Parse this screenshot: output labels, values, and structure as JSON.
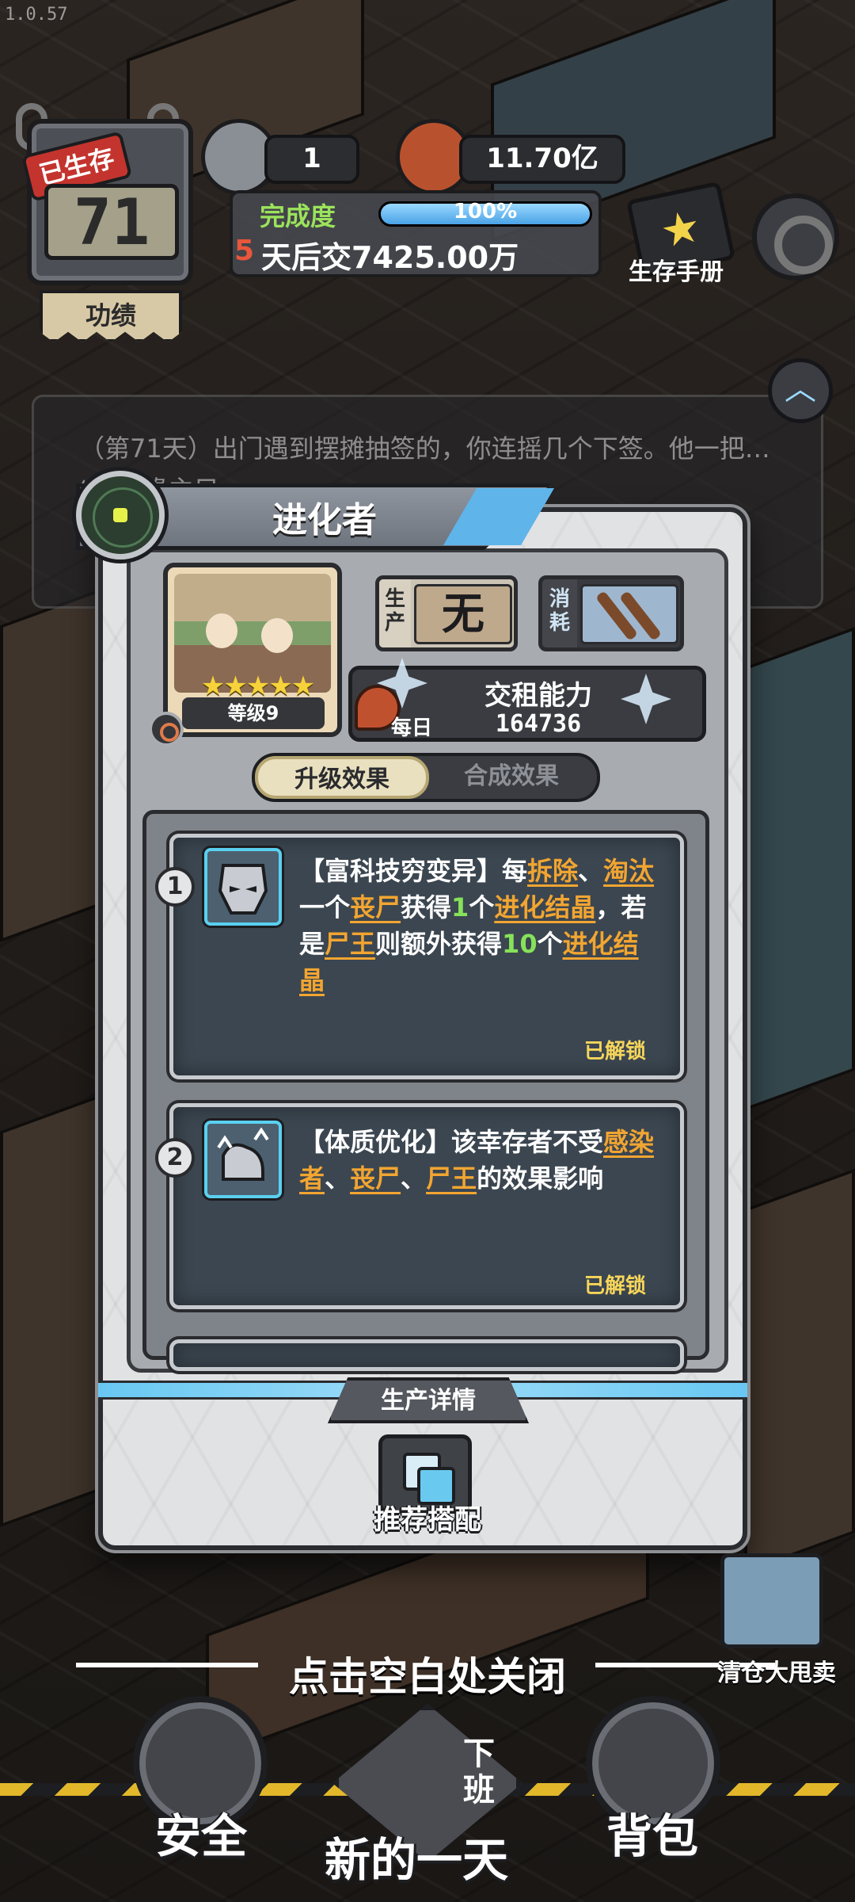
{
  "version": "1.0.57",
  "hud": {
    "survived_label": "已生存",
    "day_count": "71",
    "merit_label": "功绩",
    "resource_count": "1",
    "money": "11.70亿",
    "completion_label": "完成度",
    "completion_percent": "100%",
    "completion_value": 1.0,
    "due_days": "5",
    "due_text": "天后交7425.00万",
    "manual_label": "生存手册"
  },
  "event_log": {
    "text": "（第71天）出门遇到摆摊抽签的，你连摇几个下签。他一把… “我的缘主只"
  },
  "modal": {
    "title": "进化者",
    "level_label": "等级9",
    "stars": "★★★★★",
    "produce_label": "生产",
    "produce_value": "无",
    "consume_label": "消耗",
    "rent_title": "交租能力",
    "rent_daily_label": "每日",
    "rent_value": "164736",
    "tabs": [
      {
        "label": "升级效果",
        "active": true
      },
      {
        "label": "合成效果",
        "active": false
      }
    ],
    "effects": [
      {
        "index": "1",
        "icon": "iron-mask-icon",
        "segments": [
          {
            "t": "【富科技穷变异】每",
            "c": ""
          },
          {
            "t": "拆除",
            "c": "kw"
          },
          {
            "t": "、",
            "c": ""
          },
          {
            "t": "淘汰",
            "c": "kw"
          },
          {
            "t": "一个",
            "c": ""
          },
          {
            "t": "丧尸",
            "c": "kw"
          },
          {
            "t": "获得",
            "c": ""
          },
          {
            "t": "1",
            "c": "num"
          },
          {
            "t": "个",
            "c": ""
          },
          {
            "t": "进化结晶",
            "c": "kw"
          },
          {
            "t": "，若是",
            "c": ""
          },
          {
            "t": "尸王",
            "c": "kw"
          },
          {
            "t": "则额外获得",
            "c": ""
          },
          {
            "t": "10",
            "c": "num"
          },
          {
            "t": "个",
            "c": ""
          },
          {
            "t": "进化结晶",
            "c": "kw"
          }
        ],
        "status": "已解锁"
      },
      {
        "index": "2",
        "icon": "muscle-arm-icon",
        "segments": [
          {
            "t": "【体质优化】该幸存者不受",
            "c": ""
          },
          {
            "t": "感染者",
            "c": "kw"
          },
          {
            "t": "、",
            "c": ""
          },
          {
            "t": "丧尸",
            "c": "kw"
          },
          {
            "t": "、",
            "c": ""
          },
          {
            "t": "尸王",
            "c": "kw"
          },
          {
            "t": "的效果影响",
            "c": ""
          }
        ],
        "status": "已解锁"
      }
    ],
    "detail_tab": "生产详情",
    "recommend_label": "推荐搭配"
  },
  "close_hint": "点击空白处关闭",
  "clear_label": "清仓大甩卖",
  "bottom_nav": {
    "safety": "安全",
    "new_day": "新的一天",
    "off_work": "下班",
    "backpack": "背包"
  }
}
